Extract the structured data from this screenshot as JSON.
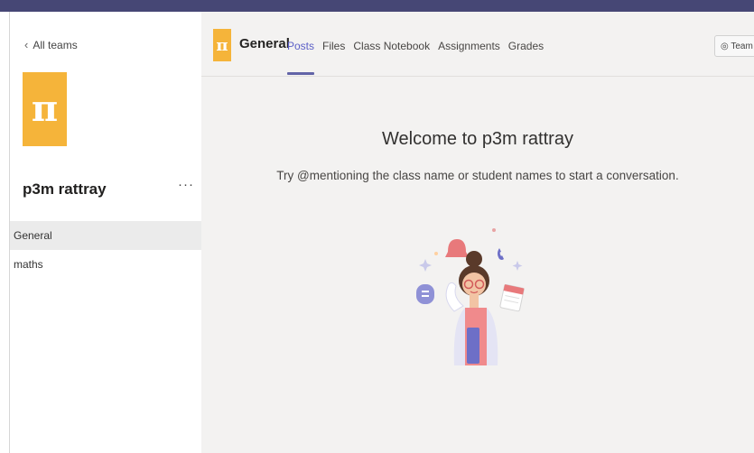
{
  "sidebar": {
    "back_label": "All teams",
    "team_initial": "π",
    "team_name": "p3m rattray",
    "more_label": "···",
    "channels": [
      {
        "label": "General"
      },
      {
        "label": "maths"
      }
    ]
  },
  "header": {
    "channel_initial": "π",
    "channel_title": "General",
    "tabs": [
      {
        "label": "Posts"
      },
      {
        "label": "Files"
      },
      {
        "label": "Class Notebook"
      },
      {
        "label": "Assignments"
      },
      {
        "label": "Grades"
      }
    ],
    "team_button_label": "Team",
    "team_button_icon": "◎"
  },
  "main": {
    "welcome_title": "Welcome to p3m rattray",
    "welcome_subtitle": "Try @mentioning the class name or student names to start a conversation."
  },
  "colors": {
    "accent": "#6264a7",
    "tile": "#f5b43a",
    "topbar": "#464775"
  }
}
